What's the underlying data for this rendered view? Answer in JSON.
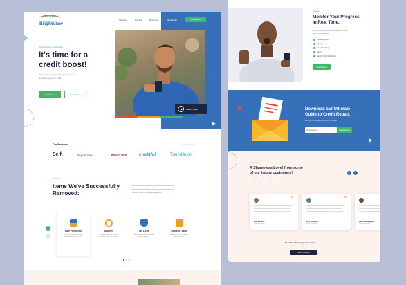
{
  "left": {
    "logo": {
      "name": "BrightView",
      "tagline": "CREDIT REPAIR"
    },
    "nav": [
      "Services",
      "Process",
      "Resources"
    ],
    "nav_client_login": "Client Login",
    "nav_cta": "Get Started",
    "hero": {
      "eyebrow": "Credit Repair Los Angeles",
      "title_line1": "It's time for a",
      "title_line2": "credit boost!",
      "desc_line1": "We take full advantage of the law to help you",
      "desc_line2": "accurately report your credit.",
      "primary_btn": "Get Started",
      "secondary_btn": "Learn More",
      "watch_video": "Watch Video"
    },
    "partners": {
      "heading": "Our Partners",
      "view_all": "View all partners",
      "logos": [
        "Self.",
        "dispute bee",
        "BRIGHTVIEW",
        "credilful",
        "TransUnion"
      ]
    },
    "services": {
      "eyebrow": "Services",
      "title_line1": "Items We've Successfully",
      "title_line2": "Removed:",
      "desc_line1": "The Fastest, Most Professional Credit Repair Specialists have",
      "desc_line2": "been helping hard-working individuals increase their score and",
      "desc_line3": "reach their goals for improving their position.",
      "items": [
        {
          "title": "Late Payments",
          "desc1": "Get rid of the late or missed",
          "desc2": "payments on your account."
        },
        {
          "title": "Inquiries",
          "desc1": "Remove hard inquiries that",
          "desc2": "are pulling your score down."
        },
        {
          "title": "Tax Liens",
          "desc1": "We'll contest tax liens holding",
          "desc2": "your credit back."
        },
        {
          "title": "Student Loans",
          "desc1": "Address errors on student",
          "desc2": "loan accounts."
        }
      ]
    }
  },
  "right": {
    "progress": {
      "eyebrow": "Process",
      "title_line1": "Monitor Your Progress",
      "title_line2": "In Real Time.",
      "desc_line1": "Through our client portal, track every dispute we send",
      "desc_line2": "and every item removed, so you always know exactly",
      "desc_line3": "where your credit stands.",
      "checklist": [
        "Credit Reports",
        "Updates",
        "Score Tracking",
        "Alerts",
        "Identity Theft Monitoring"
      ],
      "button": "Get Started"
    },
    "guide": {
      "title_line1": "Download our Ultimate",
      "title_line2": "Guide to Credit Repair.",
      "desc": "Enter your email below to get your free guide.",
      "email_placeholder": "Email address",
      "button": "Download Now"
    },
    "testimonials": {
      "eyebrow": "Testimonials",
      "title_line1": "A Shameless Love! from some",
      "title_line2": "of our happy customers!",
      "desc_line1": "Here's what our clients are saying about the results",
      "desc_line2": "we helped them achieve.",
      "cards": [
        {
          "name": "Rob Bender",
          "role": "Verified Customer"
        },
        {
          "name": "Ron Breadner",
          "role": "Verified Customer"
        },
        {
          "name": "Paul Cunningham",
          "role": "Verified Customer"
        }
      ],
      "footer_text": "See what other people are saying",
      "rating": "4.9 ★★★★★ 978 Reviews",
      "footer_button": "See All Reviews"
    }
  },
  "colors": {
    "green": "#3fb66b",
    "blue": "#2f6ab0",
    "navy": "#1c2540",
    "orange": "#f39c27"
  }
}
